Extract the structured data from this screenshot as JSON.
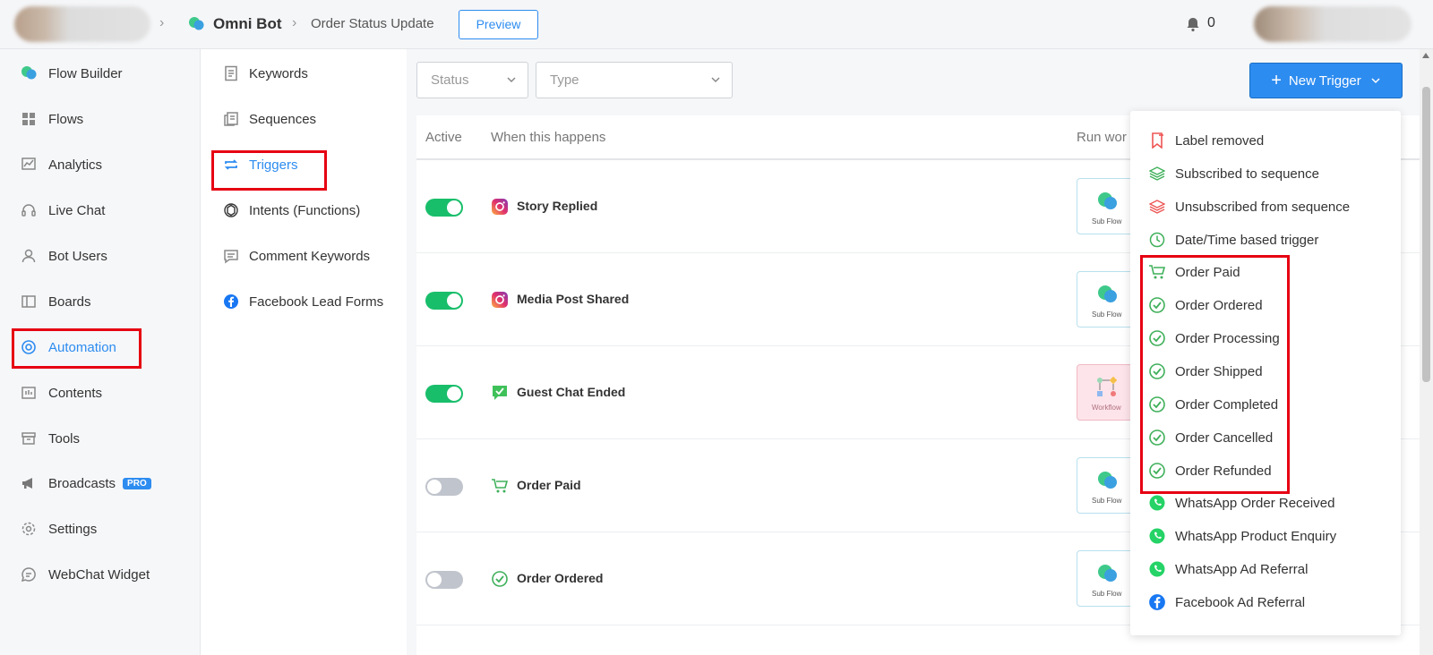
{
  "header": {
    "brand": "Omni Bot",
    "page": "Order Status Update",
    "preview_label": "Preview",
    "notifications": "0"
  },
  "sidebar": {
    "items": [
      {
        "label": "Flow Builder"
      },
      {
        "label": "Flows"
      },
      {
        "label": "Analytics"
      },
      {
        "label": "Live Chat"
      },
      {
        "label": "Bot Users"
      },
      {
        "label": "Boards"
      },
      {
        "label": "Automation"
      },
      {
        "label": "Contents"
      },
      {
        "label": "Tools"
      },
      {
        "label": "Broadcasts",
        "badge": "PRO"
      },
      {
        "label": "Settings"
      },
      {
        "label": "WebChat Widget"
      }
    ]
  },
  "subnav": {
    "items": [
      {
        "label": "Keywords"
      },
      {
        "label": "Sequences"
      },
      {
        "label": "Triggers"
      },
      {
        "label": "Intents (Functions)"
      },
      {
        "label": "Comment Keywords"
      },
      {
        "label": "Facebook Lead Forms"
      }
    ]
  },
  "filters": {
    "status_placeholder": "Status",
    "type_placeholder": "Type",
    "new_trigger_label": "New Trigger"
  },
  "table": {
    "headers": {
      "active": "Active",
      "when": "When this happens",
      "run": "Run wor"
    },
    "rows": [
      {
        "label": "Story Replied",
        "active": true,
        "card": "Sub Flow"
      },
      {
        "label": "Media Post Shared",
        "active": true,
        "card": "Sub Flow"
      },
      {
        "label": "Guest Chat Ended",
        "active": true,
        "card": "Workflow"
      },
      {
        "label": "Order Paid",
        "active": false,
        "card": "Sub Flow"
      },
      {
        "label": "Order Ordered",
        "active": false,
        "card": "Sub Flow"
      }
    ]
  },
  "dropdown": {
    "items": [
      {
        "label": "Label removed",
        "icon": "bookmark-icon"
      },
      {
        "label": "Subscribed to sequence",
        "icon": "layers-icon"
      },
      {
        "label": "Unsubscribed from sequence",
        "icon": "layers-icon"
      },
      {
        "label": "Date/Time based trigger",
        "icon": "clock-icon"
      },
      {
        "label": "Order Paid",
        "icon": "cart-icon"
      },
      {
        "label": "Order Ordered",
        "icon": "check-circle-icon"
      },
      {
        "label": "Order Processing",
        "icon": "check-circle-icon"
      },
      {
        "label": "Order Shipped",
        "icon": "check-circle-icon"
      },
      {
        "label": "Order Completed",
        "icon": "check-circle-icon"
      },
      {
        "label": "Order Cancelled",
        "icon": "check-circle-icon"
      },
      {
        "label": "Order Refunded",
        "icon": "check-circle-icon"
      },
      {
        "label": "WhatsApp Order Received",
        "icon": "whatsapp-icon"
      },
      {
        "label": "WhatsApp Product Enquiry",
        "icon": "whatsapp-icon"
      },
      {
        "label": "WhatsApp Ad Referral",
        "icon": "whatsapp-icon"
      },
      {
        "label": "Facebook Ad Referral",
        "icon": "facebook-icon"
      }
    ]
  },
  "colors": {
    "accent": "#2d8cf0",
    "toggle_on": "#19be6b",
    "highlight": "#e60012"
  }
}
